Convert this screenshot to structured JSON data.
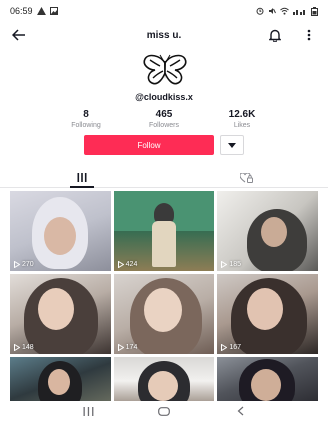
{
  "status_bar": {
    "time": "06:59",
    "left_icons": [
      "warning-icon",
      "image-icon"
    ],
    "right_icons": [
      "alarm-icon",
      "mute-icon",
      "wifi-icon",
      "signal-icon",
      "battery-icon"
    ]
  },
  "header": {
    "title": "miss u.",
    "back_icon": "arrow-left-icon",
    "bell_icon": "bell-icon",
    "menu_icon": "more-vertical-icon"
  },
  "profile": {
    "avatar_icon": "butterfly-icon",
    "username": "@cloudkiss.x",
    "stats": [
      {
        "value": "8",
        "label": "Following"
      },
      {
        "value": "465",
        "label": "Followers"
      },
      {
        "value": "12.6K",
        "label": "Likes"
      }
    ],
    "follow_label": "Follow",
    "more_icon": "chevron-down-icon"
  },
  "tabs": [
    {
      "icon": "grid-icon",
      "active": true
    },
    {
      "icon": "heart-lock-icon",
      "active": false
    }
  ],
  "videos": [
    {
      "views": "270"
    },
    {
      "views": "424"
    },
    {
      "views": "185"
    },
    {
      "views": "148"
    },
    {
      "views": "174"
    },
    {
      "views": "167"
    },
    {
      "views": ""
    },
    {
      "views": ""
    },
    {
      "views": ""
    }
  ],
  "system_nav": [
    "recents-icon",
    "home-icon",
    "back-icon"
  ],
  "colors": {
    "accent": "#fe2c55",
    "text": "#161823",
    "muted": "#8a8b91"
  }
}
